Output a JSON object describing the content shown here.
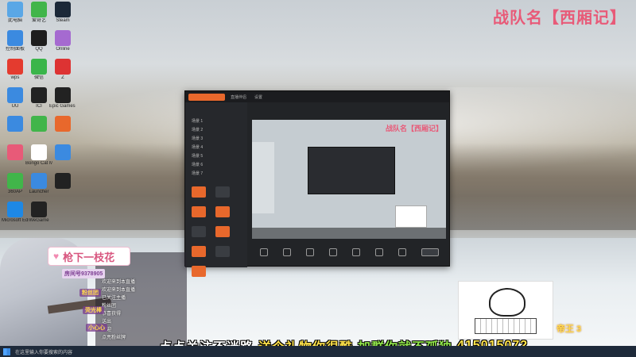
{
  "wallpaper": {
    "accent": "#e85a78"
  },
  "header": {
    "team_name": "战队名【西厢记】"
  },
  "desktop_icons": [
    {
      "label": "此电脑",
      "color": "#5aa7e6"
    },
    {
      "label": "爱奇艺",
      "color": "#41b54a"
    },
    {
      "label": "Steam",
      "color": "#1b2838"
    },
    {
      "label": "控制面板",
      "color": "#3b8ae0"
    },
    {
      "label": "QQ",
      "color": "#1e1e1e"
    },
    {
      "label": "Online",
      "color": "#a56ad0"
    },
    {
      "label": "wps",
      "color": "#e43b2f"
    },
    {
      "label": "微信",
      "color": "#3ab54a"
    },
    {
      "label": "Z",
      "color": "#d33"
    },
    {
      "label": "UU",
      "color": "#3b8ae0"
    },
    {
      "label": "ICI",
      "color": "#222"
    },
    {
      "label": "Epic Games Launcher",
      "color": "#222"
    },
    {
      "label": "",
      "color": "#3b8ae0"
    },
    {
      "label": "",
      "color": "#41b54a"
    },
    {
      "label": "",
      "color": "#e8682c"
    },
    {
      "label": "",
      "color": "#e85a78"
    },
    {
      "label": "Bongo Cat Mver",
      "color": "#fff"
    },
    {
      "label": "",
      "color": "#3b8ae0"
    },
    {
      "label": "360AP",
      "color": "#41b54a"
    },
    {
      "label": "Launcher",
      "color": "#3b8ae0"
    },
    {
      "label": "",
      "color": "#222"
    },
    {
      "label": "Microsoft Edge",
      "color": "#1e88e5"
    },
    {
      "label": "WeGame",
      "color": "#222"
    }
  ],
  "app_window": {
    "tabs": [
      "直播伴侣",
      "设置",
      "",
      ""
    ],
    "scenes": [
      "场景 1",
      "场景 2",
      "场景 3",
      "场景 4",
      "场景 5",
      "场景 6",
      "场景 7"
    ],
    "preview_team_name": "战队名【西厢记】"
  },
  "overlay": {
    "streamer_name": "枪下一枝花",
    "room_number": "房间号9378905",
    "chat": [
      "欢迎来到本直播",
      "欢迎来到本直播",
      "已关注主播",
      "粉丝团",
      "恭喜获得",
      "送出",
      "欢迎",
      "点亮粉丝牌"
    ],
    "gift_tags": [
      "粉丝团",
      "荧光棒",
      "小心心"
    ]
  },
  "ticker": {
    "part1": "点点关注不迷路",
    "part2": "送个礼物你很酷",
    "part3": "加群你就不孤独",
    "part4": "415015072"
  },
  "badge": {
    "text": "帝王 3"
  },
  "taskbar": {
    "search": "在这里输入你要搜索的内容"
  }
}
